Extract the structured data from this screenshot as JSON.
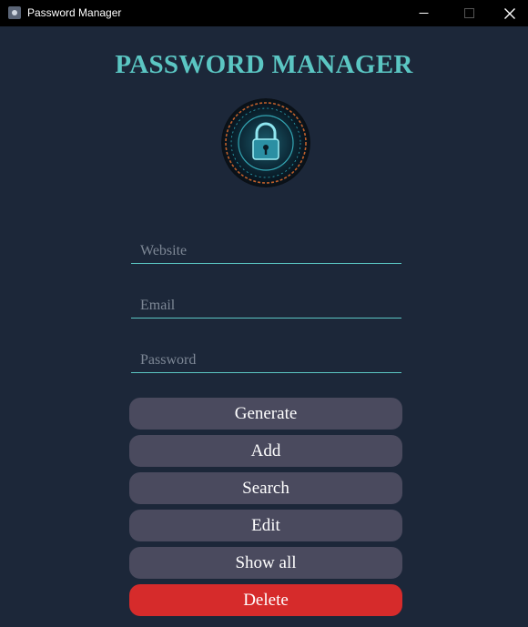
{
  "window": {
    "title": "Password Manager",
    "app_icon": "app-icon",
    "controls": {
      "minimize": "–",
      "maximize": "☐",
      "close": "✕"
    }
  },
  "header": {
    "title": "PASSWORD MANAGER",
    "logo_icon": "padlock-icon"
  },
  "form": {
    "website": {
      "placeholder": "Website",
      "value": ""
    },
    "email": {
      "placeholder": "Email",
      "value": ""
    },
    "password": {
      "placeholder": "Password",
      "value": ""
    }
  },
  "actions": {
    "generate": "Generate",
    "add": "Add",
    "search": "Search",
    "edit": "Edit",
    "show_all": "Show all",
    "delete": "Delete"
  },
  "colors": {
    "background": "#1c2739",
    "accent": "#5bc6c3",
    "button": "#4a4a5e",
    "danger": "#d62b2b"
  }
}
